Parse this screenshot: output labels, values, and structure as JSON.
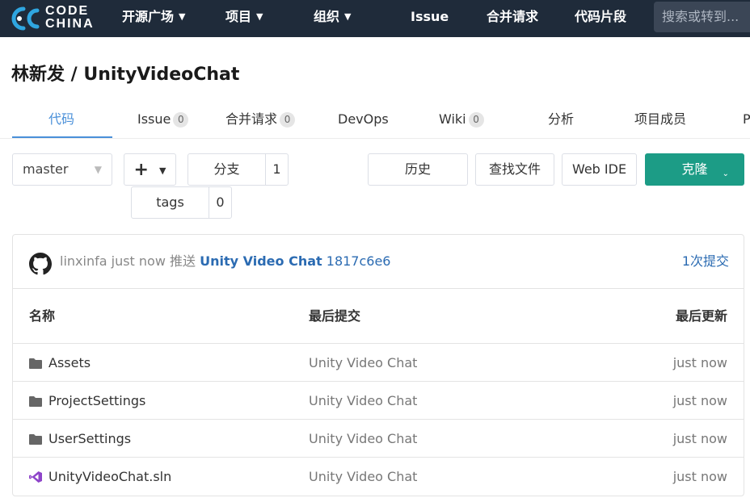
{
  "nav": {
    "logo_line1": "CODE",
    "logo_line2": "CHINA",
    "items": [
      {
        "label": "开源广场",
        "has_caret": true
      },
      {
        "label": "项目",
        "has_caret": true
      },
      {
        "label": "组织",
        "has_caret": true
      },
      {
        "label": "Issue",
        "has_caret": false
      },
      {
        "label": "合并请求",
        "has_caret": false
      },
      {
        "label": "代码片段",
        "has_caret": false
      }
    ],
    "search_placeholder": "搜索或转到..."
  },
  "repo": {
    "title": "林新发 / UnityVideoChat"
  },
  "tabs": [
    {
      "label": "代码",
      "active": true
    },
    {
      "label": "Issue",
      "badge": "0"
    },
    {
      "label": "合并请求",
      "badge": "0"
    },
    {
      "label": "DevOps"
    },
    {
      "label": "Wiki",
      "badge": "0"
    },
    {
      "label": "分析"
    },
    {
      "label": "项目成员"
    },
    {
      "label": "P"
    }
  ],
  "toolbar": {
    "branch_select": "master",
    "plus_label": "+",
    "branches_label": "分支",
    "branches_count": "1",
    "tags_label": "tags",
    "tags_count": "0",
    "history_label": "历史",
    "find_file_label": "查找文件",
    "web_ide_label": "Web IDE",
    "clone_label": "克隆"
  },
  "last_commit": {
    "author": "linxinfa",
    "time": "just now",
    "action": "推送",
    "message": "Unity Video Chat",
    "hash": "1817c6e6",
    "count_label": "1次提交"
  },
  "table": {
    "headers": {
      "name": "名称",
      "last_commit": "最后提交",
      "last_update": "最后更新"
    },
    "rows": [
      {
        "name": "Assets",
        "type": "folder",
        "commit": "Unity Video Chat",
        "updated": "just now"
      },
      {
        "name": "ProjectSettings",
        "type": "folder",
        "commit": "Unity Video Chat",
        "updated": "just now"
      },
      {
        "name": "UserSettings",
        "type": "folder",
        "commit": "Unity Video Chat",
        "updated": "just now"
      },
      {
        "name": "UnityVideoChat.sln",
        "type": "visual-studio-file",
        "commit": "Unity Video Chat",
        "updated": "just now"
      }
    ]
  },
  "colors": {
    "nav_bg": "#1f2b3a",
    "accent_blue": "#4a90d9",
    "link_blue": "#2b6bb2",
    "clone_green": "#1c9c86",
    "vs_purple": "#8e44c9"
  }
}
